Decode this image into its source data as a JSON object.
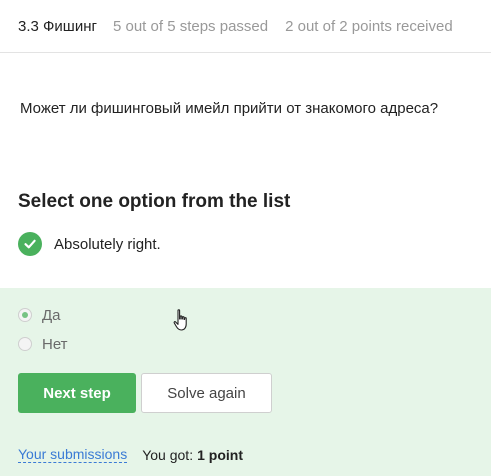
{
  "header": {
    "lesson_title": "3.3 Фишинг",
    "steps_passed": "5 out of 5 steps passed",
    "points_received": "2 out of 2 points  received"
  },
  "question": {
    "text": "Может ли фишинговый имейл прийти от знакомого адреса?"
  },
  "instruction": "Select one option from the list",
  "feedback": {
    "icon": "check-circle-icon",
    "text": "Absolutely right."
  },
  "options": [
    {
      "label": "Да",
      "selected": true
    },
    {
      "label": "Нет",
      "selected": false
    }
  ],
  "buttons": {
    "next": "Next step",
    "solve_again": "Solve again"
  },
  "footer": {
    "submissions_link": "Your submissions",
    "you_got": "You got:",
    "points": "1 point"
  },
  "colors": {
    "accent_green": "#4ab15d",
    "answer_area_bg": "#e6f5e8",
    "link_blue": "#3a7bd5"
  }
}
